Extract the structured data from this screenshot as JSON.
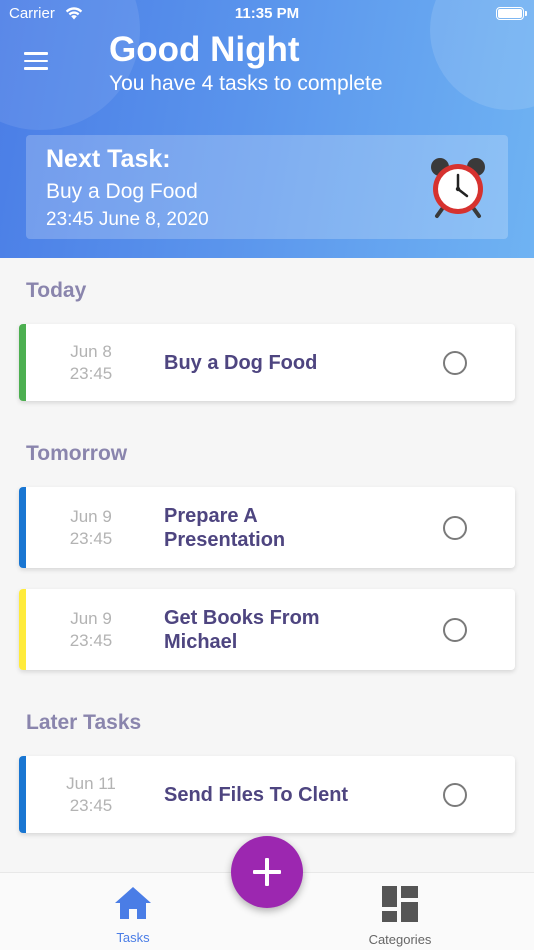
{
  "status_bar": {
    "carrier": "Carrier",
    "time": "11:35 PM"
  },
  "header": {
    "greeting": "Good Night",
    "subtitle": "You have 4 tasks to complete",
    "next_task": {
      "heading": "Next Task:",
      "name": "Buy a Dog Food",
      "datetime": "23:45 June 8, 2020",
      "icon": "alarm-clock-icon"
    }
  },
  "sections": [
    {
      "title": "Today",
      "tasks": [
        {
          "date": "Jun 8",
          "time": "23:45",
          "name": "Buy a Dog Food",
          "color": "#4caf50"
        }
      ]
    },
    {
      "title": "Tomorrow",
      "tasks": [
        {
          "date": "Jun 9",
          "time": "23:45",
          "name": "Prepare A Presentation",
          "color": "#1976d2"
        },
        {
          "date": "Jun 9",
          "time": "23:45",
          "name": "Get Books From Michael",
          "color": "#ffeb3b"
        }
      ]
    },
    {
      "title": "Later Tasks",
      "tasks": [
        {
          "date": "Jun 11",
          "time": "23:45",
          "name": "Send Files To Clent",
          "color": "#1976d2"
        }
      ]
    }
  ],
  "bottom_nav": {
    "tasks_label": "Tasks",
    "categories_label": "Categories",
    "active": "Tasks"
  },
  "colors": {
    "accent": "#4a7de6",
    "fab": "#9c27b0",
    "task_text": "#4e4580",
    "section_text": "#8a85ad"
  }
}
